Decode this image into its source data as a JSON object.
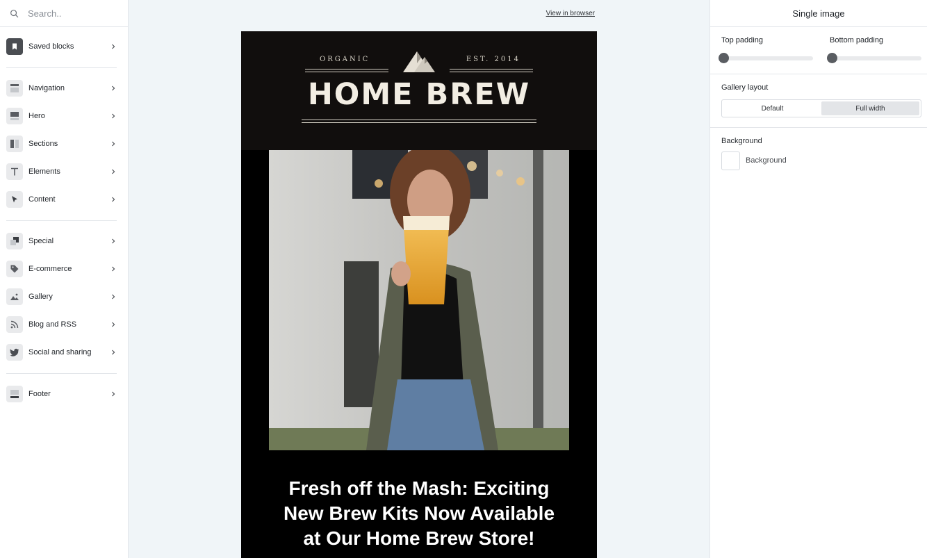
{
  "search": {
    "placeholder": "Search.."
  },
  "sidebar": {
    "items": [
      {
        "label": "Saved blocks"
      },
      {
        "label": "Navigation"
      },
      {
        "label": "Hero"
      },
      {
        "label": "Sections"
      },
      {
        "label": "Elements"
      },
      {
        "label": "Content"
      },
      {
        "label": "Special"
      },
      {
        "label": "E-commerce"
      },
      {
        "label": "Gallery"
      },
      {
        "label": "Blog and RSS"
      },
      {
        "label": "Social and sharing"
      },
      {
        "label": "Footer"
      }
    ]
  },
  "canvas": {
    "view_in_browser": "View in browser",
    "email": {
      "tagline_left": "ORGANIC",
      "tagline_right": "EST. 2014",
      "brand": "HOME BREW",
      "headline_line1": "Fresh off the Mash: Exciting",
      "headline_line2": "New Brew Kits Now Available",
      "headline_line3": "at Our Home Brew Store!"
    }
  },
  "panel": {
    "title": "Single image",
    "top_padding_label": "Top padding",
    "bottom_padding_label": "Bottom padding",
    "top_padding_value": 0,
    "bottom_padding_value": 0,
    "gallery_layout_label": "Gallery layout",
    "layout_options": [
      "Default",
      "Full width"
    ],
    "layout_selected": "Full width",
    "background_section_label": "Background",
    "background_swatch_label": "Background",
    "background_color": "#ffffff"
  },
  "colors": {
    "canvas_bg": "#f0f5f8",
    "email_header_bg": "#110e0d",
    "email_body_bg": "#000000",
    "brand_text": "#f2ede3"
  }
}
